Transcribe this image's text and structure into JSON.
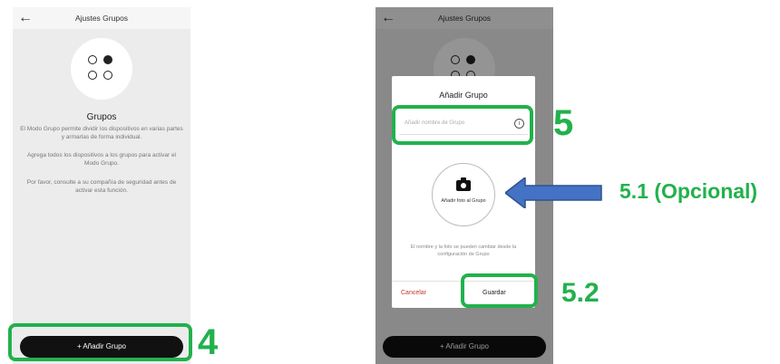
{
  "left_screen": {
    "title": "Ajustes Grupos",
    "section_title": "Grupos",
    "paragraphs": [
      "El Modo Grupo permite dividir los dispositivos en varias partes y armarlas de forma individual.",
      "Agrega todos los dispositivos a los grupos para activar el Modo Grupo.",
      "Por favor, consulte a su compañía de seguridad antes de activar esta función."
    ],
    "add_button": "+ Añadir Grupo"
  },
  "right_screen": {
    "title": "Ajustes Grupos",
    "add_button": "+ Añadir Grupo",
    "dialog": {
      "title": "Añadir Grupo",
      "name_placeholder": "Añadir nombre de Grupo",
      "info_symbol": "i",
      "photo_label": "Añadir foto al Grupo",
      "note": "El nombre y la foto se pueden cambiar desde la configuración de Grupo",
      "cancel": "Cancelar",
      "save": "Guardar"
    }
  },
  "annotations": {
    "step_4": "4",
    "step_5": "5",
    "step_5_1": "5.1 (Opcional)",
    "step_5_2": "5.2",
    "highlight_color": "#22b14c",
    "arrow_color": "#4472c4"
  },
  "icons": [
    "back-arrow-icon",
    "groups-dots-icon",
    "info-icon",
    "camera-icon",
    "left-arrow-icon"
  ]
}
